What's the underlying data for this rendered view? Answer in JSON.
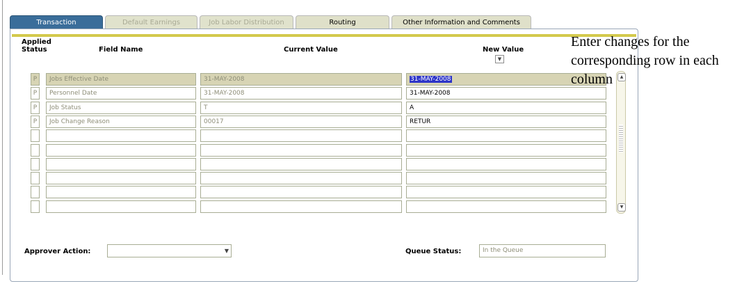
{
  "tabs": [
    {
      "label": "Transaction"
    },
    {
      "label": "Default Earnings"
    },
    {
      "label": "Job Labor Distribution"
    },
    {
      "label": "Routing"
    },
    {
      "label": "Other Information and Comments"
    }
  ],
  "headers": {
    "applied": "Applied",
    "status": "Status",
    "field_name": "Field Name",
    "current_value": "Current Value",
    "new_value": "New Value"
  },
  "rows": [
    {
      "status": "P",
      "field": "Jobs Effective Date",
      "current": "31-MAY-2008",
      "new": "31-MAY-2008"
    },
    {
      "status": "P",
      "field": "Personnel Date",
      "current": "31-MAY-2008",
      "new": "31-MAY-2008"
    },
    {
      "status": "P",
      "field": "Job Status",
      "current": "T",
      "new": "A"
    },
    {
      "status": "P",
      "field": "Job Change Reason",
      "current": "00017",
      "new": "RETUR"
    },
    {
      "status": "",
      "field": "",
      "current": "",
      "new": ""
    },
    {
      "status": "",
      "field": "",
      "current": "",
      "new": ""
    },
    {
      "status": "",
      "field": "",
      "current": "",
      "new": ""
    },
    {
      "status": "",
      "field": "",
      "current": "",
      "new": ""
    },
    {
      "status": "",
      "field": "",
      "current": "",
      "new": ""
    },
    {
      "status": "",
      "field": "",
      "current": "",
      "new": ""
    }
  ],
  "approver_action": {
    "label": "Approver Action:",
    "value": ""
  },
  "queue_status": {
    "label": "Queue Status:",
    "value": "In the Queue"
  },
  "annotation": "Enter changes for the corresponding row in each column",
  "colors": {
    "active_tab": "#3a6d9a",
    "accent": "#d3c94c",
    "highlight": "#d7d4b4",
    "selection": "#2d34c8"
  }
}
